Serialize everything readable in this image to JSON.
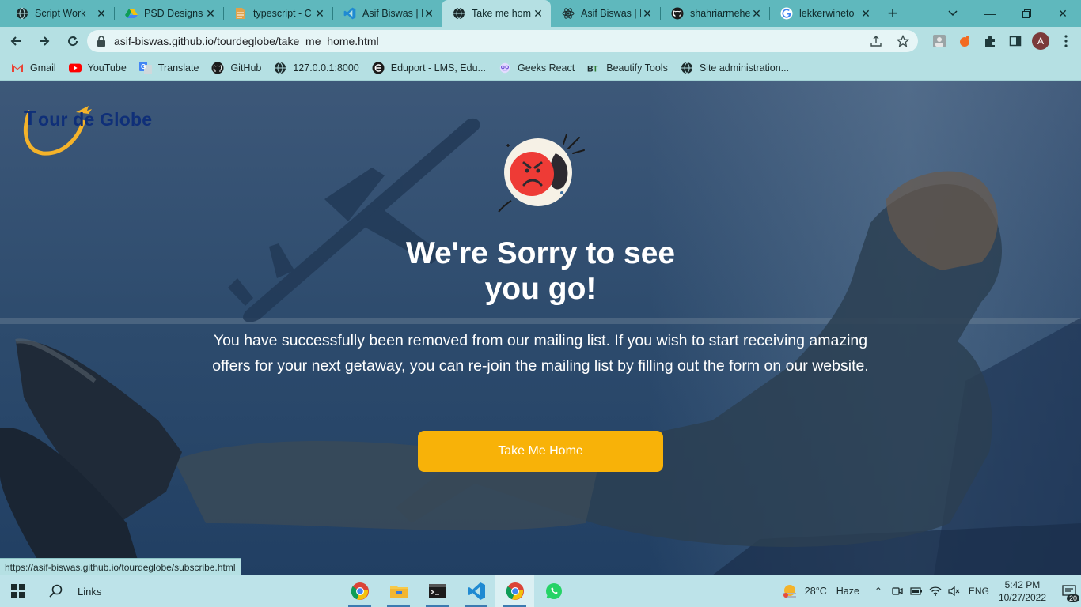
{
  "browser": {
    "tabs": [
      {
        "title": "Script Work",
        "icon": "globe-icon",
        "active": false
      },
      {
        "title": "PSD Designs",
        "icon": "drive-icon",
        "active": false
      },
      {
        "title": "typescript - C",
        "icon": "doc-icon",
        "active": false
      },
      {
        "title": "Asif Biswas | F",
        "icon": "vscode-icon",
        "active": false
      },
      {
        "title": "Take me hom",
        "icon": "globe-icon",
        "active": true
      },
      {
        "title": "Asif Biswas | F",
        "icon": "react-icon",
        "active": false
      },
      {
        "title": "shahriarmehe",
        "icon": "github-icon",
        "active": false
      },
      {
        "title": "lekkerwineto",
        "icon": "google-icon",
        "active": false
      }
    ],
    "url": "asif-biswas.github.io/tourdeglobe/take_me_home.html",
    "profile_initial": "A",
    "bookmarks": [
      {
        "label": "Gmail",
        "icon": "gmail-icon"
      },
      {
        "label": "YouTube",
        "icon": "youtube-icon"
      },
      {
        "label": "Translate",
        "icon": "translate-icon"
      },
      {
        "label": "GitHub",
        "icon": "github-icon"
      },
      {
        "label": "127.0.0.1:8000",
        "icon": "globe-icon"
      },
      {
        "label": "Eduport - LMS, Edu...",
        "icon": "eduport-icon"
      },
      {
        "label": "Geeks React",
        "icon": "geeks-icon"
      },
      {
        "label": "Beautify Tools",
        "icon": "bt-icon"
      },
      {
        "label": "Site administration...",
        "icon": "globe-icon"
      }
    ],
    "status_url": "https://asif-biswas.github.io/tourdeglobe/subscribe.html"
  },
  "page": {
    "logo_text_t": "T",
    "logo_text": "our de Globe",
    "headline_line1": "We're Sorry to see",
    "headline_line2": "you go!",
    "message": "You have successfully been removed from our mailing list. If you wish to start receiving amazing offers for your next getaway, you can re-join the mailing list by filling out the form on our website.",
    "button_label": "Take Me Home",
    "colors": {
      "accent": "#f8b208",
      "logo_blue": "#0f2f78",
      "overlay": "#2d4b6d"
    }
  },
  "taskbar": {
    "search_label": "Links",
    "apps": [
      "chrome-icon",
      "file-explorer-icon",
      "terminal-icon",
      "vscode-icon",
      "chrome-icon",
      "whatsapp-icon"
    ],
    "weather_temp": "28°C",
    "weather_desc": "Haze",
    "language": "ENG",
    "time": "5:42 PM",
    "date": "10/27/2022",
    "notification_count": "20"
  }
}
